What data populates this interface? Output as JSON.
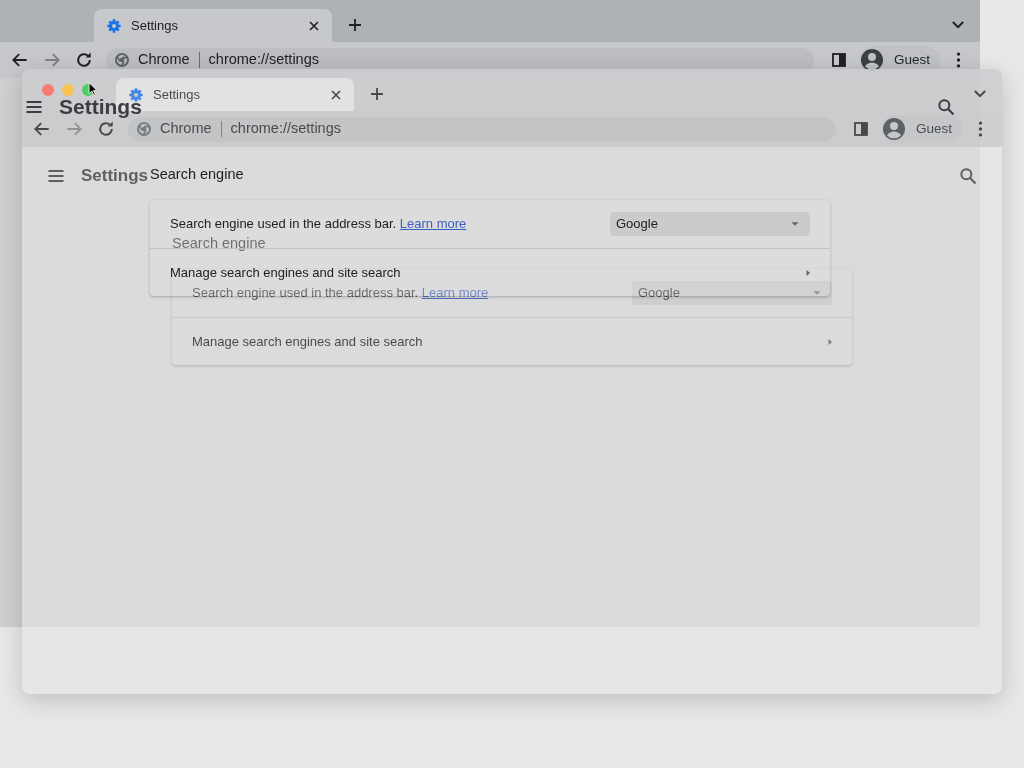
{
  "window": {
    "tabs": [
      {
        "title": "Settings",
        "selected": true
      }
    ],
    "address": {
      "origin": "Chrome",
      "url": "chrome://settings"
    },
    "profile": "Guest",
    "page": {
      "title": "Settings",
      "section": "Search engine",
      "rows": [
        {
          "kind": "select",
          "label": "Search engine used in the address bar.",
          "link": "Learn more",
          "value": "Google"
        },
        {
          "kind": "link",
          "label": "Manage search engines and site search"
        }
      ]
    }
  },
  "opening_window": {
    "window_controls": true,
    "tabs": [
      {
        "title": "Settings",
        "selected": true
      }
    ],
    "address": {
      "origin": "Chrome",
      "url": "chrome://settings"
    },
    "profile": "Guest",
    "page": {
      "title": "Settings",
      "section": "Search engine",
      "rows": [
        {
          "kind": "select",
          "label": "Search engine used in the address bar.",
          "link": "Learn more",
          "value": "Google"
        },
        {
          "kind": "link",
          "label": "Manage search engines and site search"
        }
      ]
    }
  }
}
